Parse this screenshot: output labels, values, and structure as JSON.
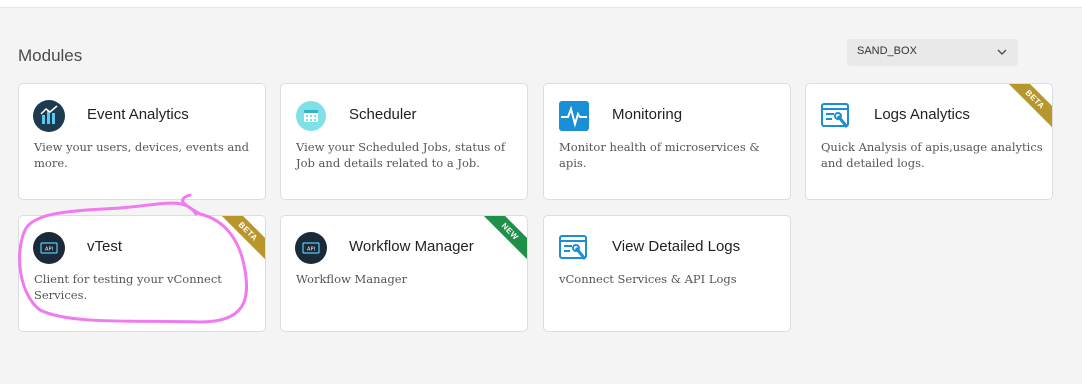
{
  "header": {
    "title": "Modules"
  },
  "environment": {
    "selected": "SAND_BOX"
  },
  "colors": {
    "beta": "#b8962e",
    "new": "#1f8f4a",
    "annotation": "#f07af0"
  },
  "modules": [
    {
      "name": "Event Analytics",
      "description": "View your users, devices, events and more.",
      "icon": "bar-chart-icon",
      "badge": ""
    },
    {
      "name": "Scheduler",
      "description": "View your Scheduled Jobs, status of Job and details related to a Job.",
      "icon": "calendar-icon",
      "badge": ""
    },
    {
      "name": "Monitoring",
      "description": "Monitor health of microservices & apis.",
      "icon": "heartbeat-icon",
      "badge": ""
    },
    {
      "name": "Logs Analytics",
      "description": "Quick Analysis of apis,usage analytics and detailed logs.",
      "icon": "logs-analytics-icon",
      "badge": "BETA"
    },
    {
      "name": "vTest",
      "description": "Client for testing your vConnect Services.",
      "icon": "api-test-icon",
      "badge": "BETA"
    },
    {
      "name": "Workflow Manager",
      "description": "Workflow Manager",
      "icon": "workflow-icon",
      "badge": "NEW"
    },
    {
      "name": "View Detailed Logs",
      "description": "vConnect Services & API Logs",
      "icon": "detailed-logs-icon",
      "badge": ""
    }
  ]
}
